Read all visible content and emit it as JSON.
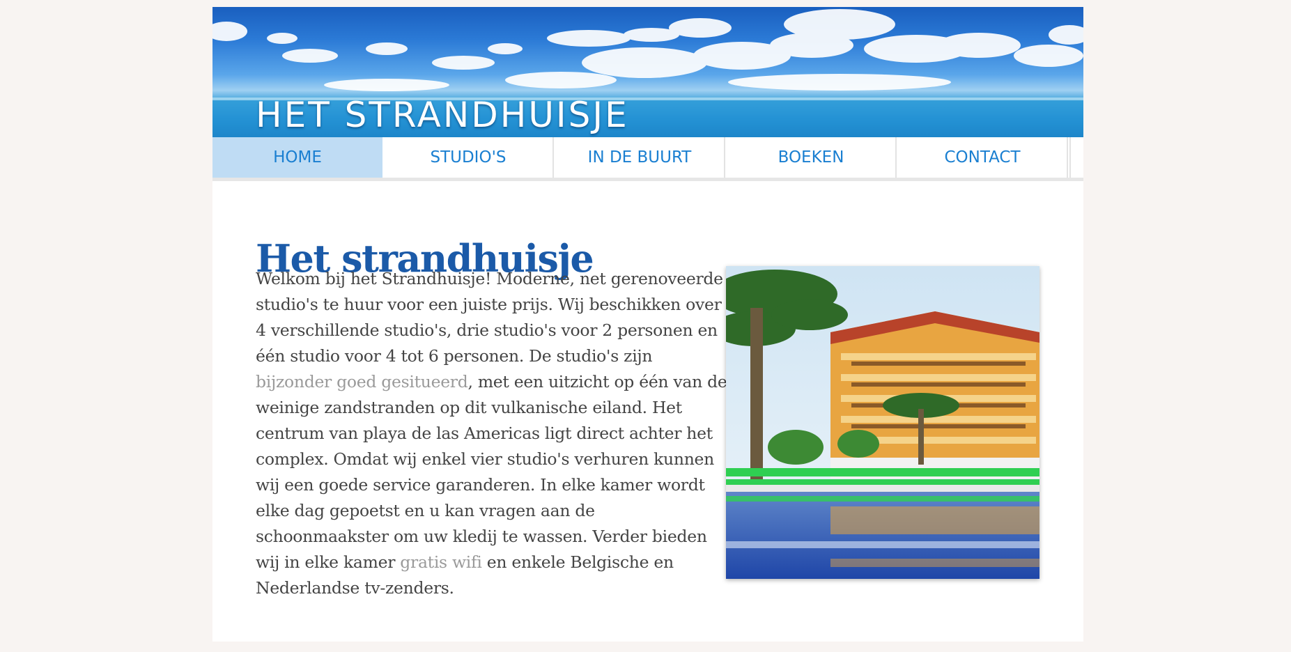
{
  "header": {
    "site_title": "HET STRANDHUISJE"
  },
  "nav": {
    "items": [
      {
        "label": "HOME",
        "active": true
      },
      {
        "label": "STUDIO'S",
        "active": false
      },
      {
        "label": "IN DE BUURT",
        "active": false
      },
      {
        "label": "BOEKEN",
        "active": false
      },
      {
        "label": "CONTACT",
        "active": false
      }
    ]
  },
  "main": {
    "title": "Het strandhuisje",
    "intro_part1": "Welkom bij het Strandhuisje! Moderne, net gerenoveerde studio's te huur voor een juiste prijs. Wij beschikken over 4 verschillende studio's, drie studio's voor 2 personen en één studio voor 4 tot 6 personen. De studio's zijn ",
    "intro_link1": "bijzonder goed gesitueerd",
    "intro_part2": ", met een uitzicht op één van de weinige zandstranden op dit vulkanische eiland. Het centrum van playa de las Americas ligt direct achter het complex. Omdat wij enkel vier studio's verhuren kunnen wij een goede service garanderen. In elke kamer wordt elke dag gepoetst en u kan vragen aan de schoonmaakster om uw kledij te wassen. Verder bieden wij in elke kamer ",
    "intro_link2": "gratis wifi",
    "intro_part3": " en enkele Belgische en Nederlandse tv-zenders."
  },
  "colors": {
    "page_bg": "#f8f4f2",
    "nav_text": "#1a7fd1",
    "nav_active_bg": "#bfdcf4",
    "title": "#1b5aa8"
  }
}
